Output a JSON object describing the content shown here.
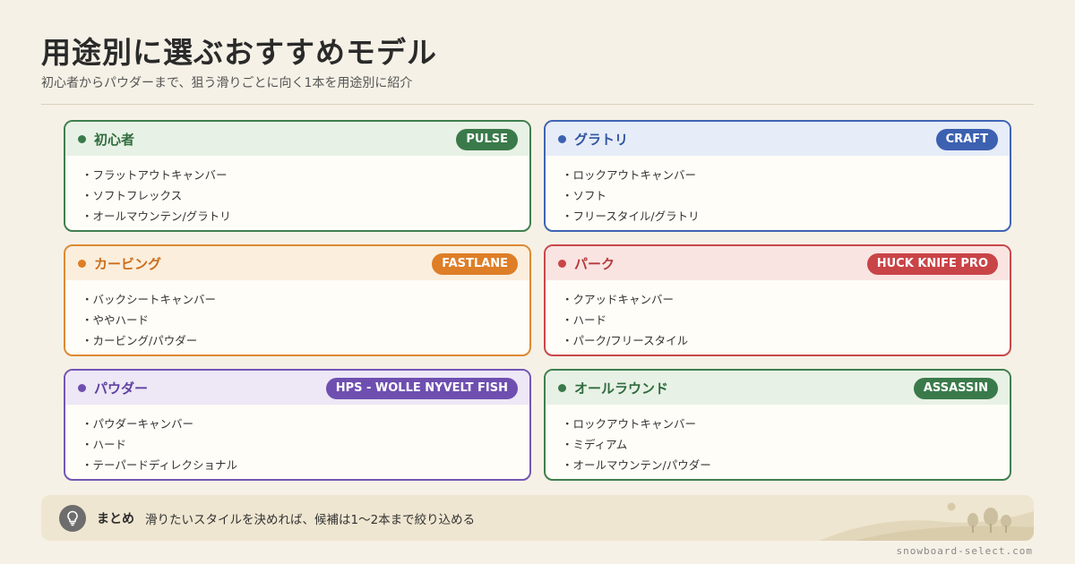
{
  "header": {
    "title": "用途別に選ぶおすすめモデル",
    "subtitle": "初心者からパウダーまで、狙う滑りごとに向く1本を用途別に紹介"
  },
  "cards": [
    {
      "title": "初心者",
      "badge": "PULSE",
      "items": [
        "・フラットアウトキャンバー",
        "・ソフトフレックス",
        "・オールマウンテン/グラトリ"
      ]
    },
    {
      "title": "グラトリ",
      "badge": "CRAFT",
      "items": [
        "・ロックアウトキャンバー",
        "・ソフト",
        "・フリースタイル/グラトリ"
      ]
    },
    {
      "title": "カービング",
      "badge": "FASTLANE",
      "items": [
        "・バックシートキャンバー",
        "・ややハード",
        "・カービング/パウダー"
      ]
    },
    {
      "title": "パーク",
      "badge": "HUCK KNIFE PRO",
      "items": [
        "・クアッドキャンバー",
        "・ハード",
        "・パーク/フリースタイル"
      ]
    },
    {
      "title": "パウダー",
      "badge": "HPS - WOLLE NYVELT FISH",
      "items": [
        "・パウダーキャンバー",
        "・ハード",
        "・テーパードディレクショナル"
      ]
    },
    {
      "title": "オールラウンド",
      "badge": "ASSASSIN",
      "items": [
        "・ロックアウトキャンバー",
        "・ミディアム",
        "・オールマウンテン/パウダー"
      ]
    }
  ],
  "summary": {
    "icon": "lightbulb-icon",
    "label": "まとめ",
    "text": "滑りたいスタイルを決めれば、候補は1〜2本まで絞り込める"
  },
  "footer": "snowboard-select.com",
  "colors": {
    "background": "#f6f1e6",
    "green": "#3a7a4a",
    "blue": "#3c61b0",
    "orange": "#de7e27",
    "red": "#c94447",
    "purple": "#6e4fb0"
  }
}
